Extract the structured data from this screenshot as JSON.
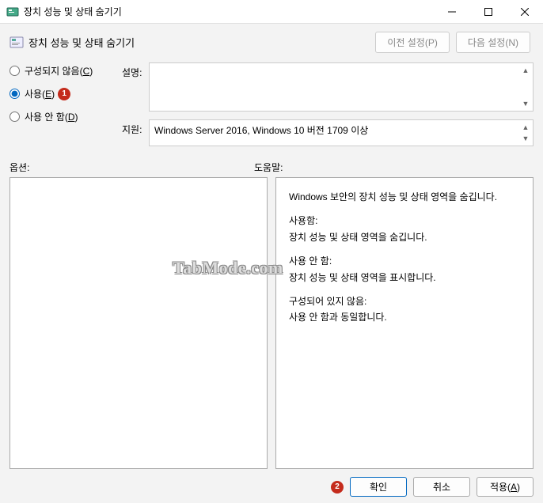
{
  "window": {
    "title": "장치 성능 및 상태 숨기기"
  },
  "header": {
    "title": "장치 성능 및 상태 숨기기",
    "prev_btn": "이전 설정(P)",
    "next_btn": "다음 설정(N)"
  },
  "radios": {
    "not_configured": "구성되지 않음(C)",
    "enabled": "사용(E)",
    "disabled": "사용 안 함(D)",
    "badge1": "1"
  },
  "fields": {
    "desc_label": "설명:",
    "support_label": "지원:",
    "support_value": "Windows Server 2016, Windows 10 버전 1709 이상"
  },
  "panels": {
    "options_label": "옵션:",
    "help_label": "도움말:",
    "help_p1": "Windows 보안의 장치 성능 및 상태 영역을 숨깁니다.",
    "help_p2a": "사용함:",
    "help_p2b": "장치 성능 및 상태 영역을 숨깁니다.",
    "help_p3a": "사용 안 함:",
    "help_p3b": "장치 성능 및 상태 영역을 표시합니다.",
    "help_p4a": "구성되어 있지 않음:",
    "help_p4b": "사용 안 함과 동일합니다."
  },
  "footer": {
    "badge2": "2",
    "ok": "확인",
    "cancel": "취소",
    "apply": "적용(A)"
  },
  "watermark": "TabMode.com"
}
